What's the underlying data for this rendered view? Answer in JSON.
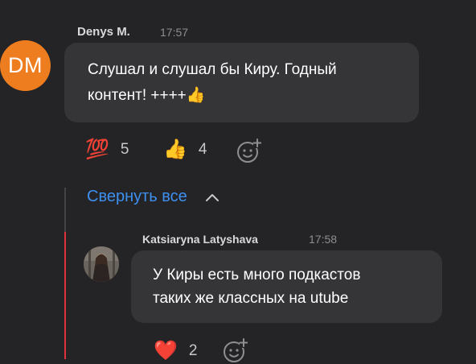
{
  "comments": [
    {
      "avatar_initials": "DM",
      "author": "Denys M.",
      "time": "17:57",
      "text_line1": "Слушал и слушал бы Киру. Годный",
      "text_line2": "контент!  ++++👍",
      "reactions": [
        {
          "emoji": "💯",
          "count": "5"
        },
        {
          "emoji": "👍",
          "count": "4"
        }
      ]
    },
    {
      "author": "Katsiaryna Latyshava",
      "time": "17:58",
      "text_line1": "У Киры есть много подкастов",
      "text_line2": "таких же классных на utube",
      "reactions": [
        {
          "emoji": "❤️",
          "count": "2"
        }
      ]
    }
  ],
  "thread": {
    "collapse_label": "Свернуть все"
  },
  "colors": {
    "background": "#242426",
    "bubble": "#353538",
    "avatar_dm": "#ee7d1f",
    "link_blue": "#3d8ff0",
    "thread_red": "#e0323a"
  },
  "icons": [
    "add-reaction-icon",
    "chevron-up-icon"
  ]
}
